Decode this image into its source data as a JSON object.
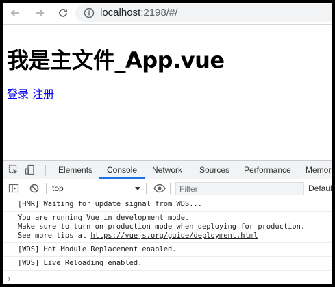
{
  "browser": {
    "url_host": "localhost",
    "url_rest": ":2198/#/"
  },
  "page": {
    "title": "我是主文件_App.vue",
    "links": [
      "登录",
      "注册"
    ]
  },
  "devtools": {
    "tabs": [
      "Elements",
      "Console",
      "Network",
      "Sources",
      "Performance",
      "Memor"
    ],
    "active_tab": "Console",
    "context": "top",
    "filter_placeholder": "Filter",
    "levels": "Defaul",
    "messages": [
      "[HMR] Waiting for update signal from WDS...",
      "You are running Vue in development mode.",
      "Make sure to turn on production mode when deploying for production.",
      "See more tips at",
      "https://vuejs.org/guide/deployment.html",
      "[WDS] Hot Module Replacement enabled.",
      "[WDS] Live Reloading enabled."
    ],
    "prompt": "›"
  },
  "colors": {
    "link": "#0000ee",
    "active_tab_underline": "#1a73e8"
  }
}
